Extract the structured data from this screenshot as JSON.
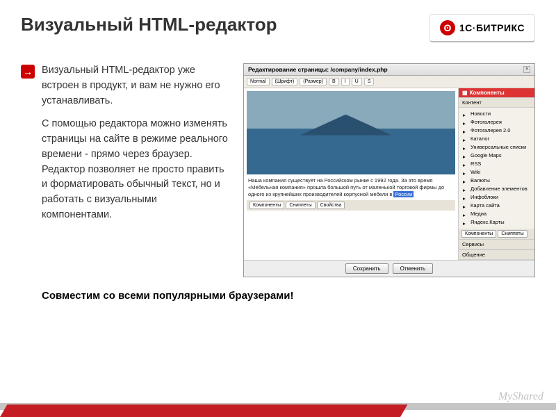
{
  "header": {
    "title": "Визуальный HTML-редактор",
    "logo_symbol": "ʘ",
    "logo_text": "1С·БИТРИКС"
  },
  "bullet": "→",
  "description": {
    "p1": "Визуальный HTML-редактор уже встроен в продукт, и вам не нужно его устанавливать.",
    "p2": "С помощью редактора можно изменять страницы на сайте в режиме реального времени - прямо через браузер. Редактор позволяет не просто править и форматировать обычный текст, но и работать с визуальными компонентами."
  },
  "editor": {
    "title": "Редактирование страницы: /company/index.php",
    "toolbar": {
      "style": "Normal",
      "font": "(Шрифт)",
      "size": "(Размер)",
      "b": "B",
      "i": "I",
      "u": "U",
      "s": "S"
    },
    "body_text": "Наша компания существует на Российском рынке с 1992 года. За это время «Мебельная компания» прошла большой путь от маленькой торговой фирмы до одного из крупнейших производителей корпусной мебели в",
    "highlight": "России",
    "side": {
      "head": "Компоненты",
      "section": "Контент",
      "items": [
        "Новости",
        "Фотогалерея",
        "Фотогалерея 2.0",
        "Каталог",
        "Универсальные списки",
        "Google Maps",
        "RSS",
        "Wiki",
        "Валюты",
        "Добавление элементов",
        "Инфоблоки",
        "Карта сайта",
        "Медиа",
        "Яндекс.Карты"
      ],
      "tabs_label1": "Компоненты",
      "tabs_label2": "Сниппеты",
      "sec_services": "Сервисы",
      "sec_social": "Общение"
    },
    "footer_tabs": {
      "t1": "Компоненты",
      "t2": "Сниппеты",
      "t3": "Свойства"
    },
    "buttons": {
      "save": "Сохранить",
      "cancel": "Отменить"
    }
  },
  "footnote": "Совместим со всеми популярными браузерами!",
  "watermark": "MyShared"
}
